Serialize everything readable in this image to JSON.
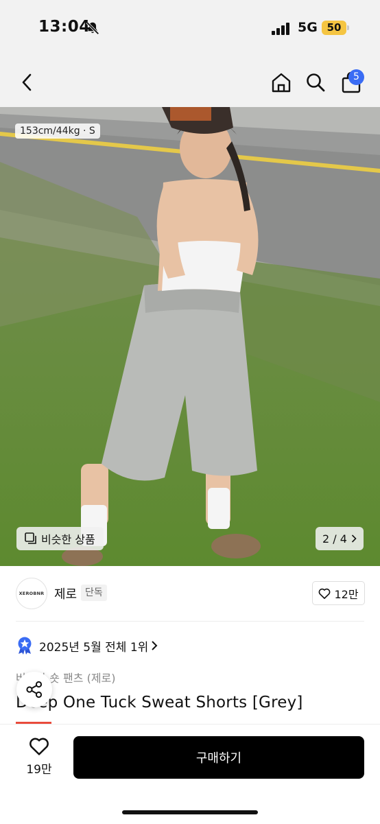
{
  "status_bar": {
    "time": "13:04",
    "network": "5G",
    "battery": "50"
  },
  "header": {
    "cart_count": "5"
  },
  "photo": {
    "size_info": "153cm/44kg · S",
    "similar_label": "비슷한 상품",
    "page_indicator": "2 / 4"
  },
  "brand": {
    "logo_text": "XEROBNR",
    "name": "제로",
    "badge": "단독",
    "like_count": "12만"
  },
  "product": {
    "ranking": "2025년 5월 전체 1위",
    "category": "버뮤다 숏 팬츠 (제로)",
    "title": "Deep One Tuck Sweat Shorts [Grey]"
  },
  "bottom_bar": {
    "heart_count": "19만",
    "buy_label": "구매하기"
  },
  "colors": {
    "accent_blue": "#3a6cf4",
    "battery_yellow": "#f5c542",
    "sale_red": "#e94b3c",
    "buy_button": "#000000"
  }
}
